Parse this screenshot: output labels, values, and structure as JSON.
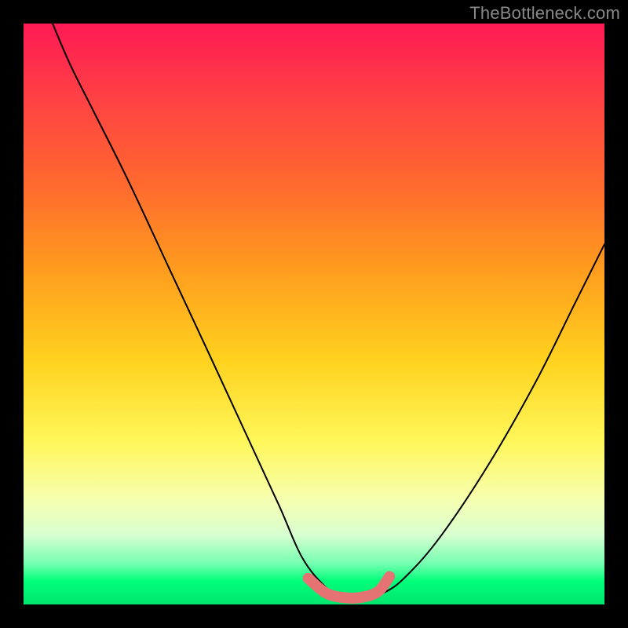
{
  "watermark": "TheBottleneck.com",
  "colors": {
    "curve": "#000000",
    "highlight": "#e57373",
    "gradient_top": "#ff1a55",
    "gradient_bottom": "#00e56e"
  },
  "chart_data": {
    "type": "line",
    "title": "",
    "xlabel": "",
    "ylabel": "",
    "xlim": [
      0,
      100
    ],
    "ylim": [
      0,
      100
    ],
    "grid": false,
    "legend": false,
    "annotations": [],
    "series": [
      {
        "name": "bottleneck-curve",
        "x": [
          5,
          8,
          12,
          18,
          25,
          32,
          38,
          44,
          48,
          52,
          55,
          58,
          62,
          66,
          72,
          80,
          88,
          95,
          100
        ],
        "y": [
          100,
          93,
          85,
          73,
          58,
          43,
          30,
          17,
          8,
          3,
          1,
          1,
          2,
          5,
          12,
          24,
          38,
          52,
          62
        ]
      }
    ],
    "highlight_segment": {
      "name": "trough-highlight",
      "x": [
        49,
        52,
        55,
        58,
        61,
        63
      ],
      "y": [
        4.5,
        2.0,
        1.2,
        1.2,
        2.2,
        4.8
      ]
    }
  }
}
